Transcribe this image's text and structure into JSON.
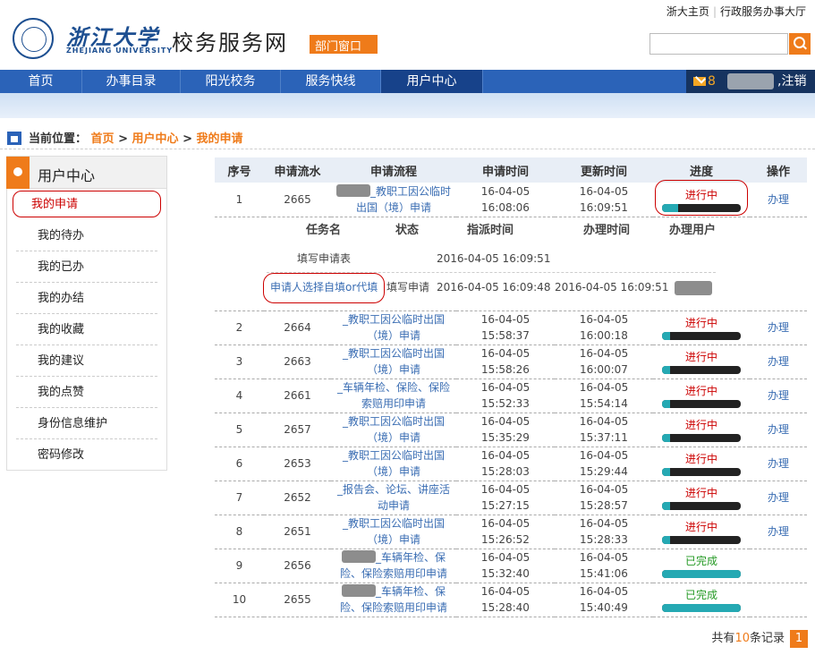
{
  "top_links": [
    "浙大主页",
    "行政服务办事大厅"
  ],
  "brand": {
    "cn": "浙江大学",
    "en": "ZHEJIANG UNIVERSITY",
    "site_title": "校务服务网",
    "dept_button": "部门窗口"
  },
  "nav": {
    "items": [
      "首页",
      "办事目录",
      "阳光校务",
      "服务快线",
      "用户中心"
    ],
    "active": "用户中心",
    "mail_count": "8",
    "logout": "注销"
  },
  "breadcrumb": {
    "prefix": "当前位置：",
    "items": [
      "首页",
      "用户中心",
      "我的申请"
    ],
    "sep": ">"
  },
  "sidebar": {
    "title": "用户中心",
    "items": [
      "我的申请",
      "我的待办",
      "我的已办",
      "我的办结",
      "我的收藏",
      "我的建议",
      "我的点赞",
      "身份信息维护",
      "密码修改"
    ]
  },
  "table": {
    "headers": [
      "序号",
      "申请流水",
      "申请流程",
      "申请时间",
      "更新时间",
      "进度",
      "操作"
    ],
    "rows": [
      {
        "no": "1",
        "serial": "2665",
        "flow_a": "_教职工因公临时",
        "flow_b": "出国（境）申请",
        "apply_date": "16-04-05",
        "apply_time": "16:08:06",
        "update_date": "16-04-05",
        "update_time": "16:09:51",
        "status": "进行中",
        "progress": 0.2,
        "op": "办理"
      },
      {
        "no": "2",
        "serial": "2664",
        "flow_a": "_教职工因公临时出国",
        "flow_b": "（境）申请",
        "apply_date": "16-04-05",
        "apply_time": "15:58:37",
        "update_date": "16-04-05",
        "update_time": "16:00:18",
        "status": "进行中",
        "progress": 0.1,
        "op": "办理"
      },
      {
        "no": "3",
        "serial": "2663",
        "flow_a": "_教职工因公临时出国",
        "flow_b": "（境）申请",
        "apply_date": "16-04-05",
        "apply_time": "15:58:26",
        "update_date": "16-04-05",
        "update_time": "16:00:07",
        "status": "进行中",
        "progress": 0.1,
        "op": "办理"
      },
      {
        "no": "4",
        "serial": "2661",
        "flow_a": "_车辆年检、保险、保险",
        "flow_b": "索赔用印申请",
        "apply_date": "16-04-05",
        "apply_time": "15:52:33",
        "update_date": "16-04-05",
        "update_time": "15:54:14",
        "status": "进行中",
        "progress": 0.1,
        "op": "办理"
      },
      {
        "no": "5",
        "serial": "2657",
        "flow_a": "_教职工因公临时出国",
        "flow_b": "（境）申请",
        "apply_date": "16-04-05",
        "apply_time": "15:35:29",
        "update_date": "16-04-05",
        "update_time": "15:37:11",
        "status": "进行中",
        "progress": 0.1,
        "op": "办理"
      },
      {
        "no": "6",
        "serial": "2653",
        "flow_a": "_教职工因公临时出国",
        "flow_b": "（境）申请",
        "apply_date": "16-04-05",
        "apply_time": "15:28:03",
        "update_date": "16-04-05",
        "update_time": "15:29:44",
        "status": "进行中",
        "progress": 0.1,
        "op": "办理"
      },
      {
        "no": "7",
        "serial": "2652",
        "flow_a": "_报告会、论坛、讲座活",
        "flow_b": "动申请",
        "apply_date": "16-04-05",
        "apply_time": "15:27:15",
        "update_date": "16-04-05",
        "update_time": "15:28:57",
        "status": "进行中",
        "progress": 0.1,
        "op": "办理"
      },
      {
        "no": "8",
        "serial": "2651",
        "flow_a": "_教职工因公临时出国",
        "flow_b": "（境）申请",
        "apply_date": "16-04-05",
        "apply_time": "15:26:52",
        "update_date": "16-04-05",
        "update_time": "15:28:33",
        "status": "进行中",
        "progress": 0.1,
        "op": "办理"
      },
      {
        "no": "9",
        "serial": "2656",
        "flow_a": "_车辆年检、保",
        "flow_b": "险、保险索赔用印申请",
        "apply_date": "16-04-05",
        "apply_time": "15:32:40",
        "update_date": "16-04-05",
        "update_time": "15:41:06",
        "status": "已完成",
        "progress": 1.0,
        "op": ""
      },
      {
        "no": "10",
        "serial": "2655",
        "flow_a": "_车辆年检、保",
        "flow_b": "险、保险索赔用印申请",
        "apply_date": "16-04-05",
        "apply_time": "15:28:40",
        "update_date": "16-04-05",
        "update_time": "15:40:49",
        "status": "已完成",
        "progress": 1.0,
        "op": ""
      }
    ]
  },
  "subtable": {
    "headers": [
      "任务名",
      "状态",
      "指派时间",
      "办理时间",
      "办理用户"
    ],
    "rows": [
      {
        "task": "填写申请表",
        "state": "",
        "assign": "2016-04-05 16:09:51",
        "done": ""
      },
      {
        "task": "申请人选择自填or代填",
        "state": "填写申请",
        "assign": "2016-04-05 16:09:48",
        "done": "2016-04-05 16:09:51"
      }
    ]
  },
  "footer": {
    "prefix": "共有",
    "count": "10",
    "suffix": "条记录",
    "page": "1"
  },
  "colors": {
    "brand_blue": "#2b63b8",
    "accent_orange": "#ef7b1a",
    "status_running": "#cc0000",
    "status_done": "#229922",
    "progress_fill": "#25a9b3"
  }
}
